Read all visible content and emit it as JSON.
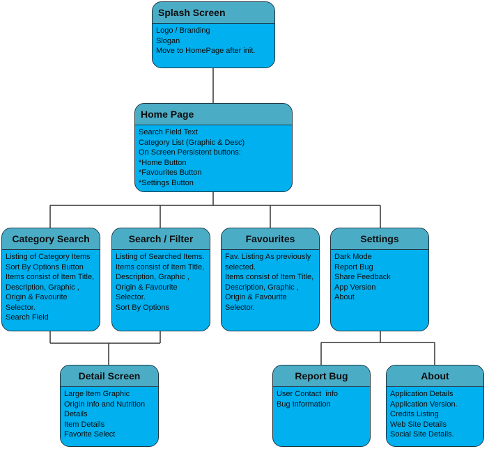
{
  "diagram": {
    "type": "sitemap",
    "colors": {
      "header": "#4bacc6",
      "body": "#00b0ef",
      "border": "#1f3640",
      "connector": "#333333"
    },
    "nodes": {
      "splash": {
        "title": "Splash Screen",
        "lines": [
          "Logo / Branding",
          "Slogan",
          "Move to HomePage after init."
        ]
      },
      "home": {
        "title": "Home Page",
        "lines": [
          "Search Field Text",
          "Category List (Graphic & Desc)",
          "On Screen Persistent buttons:",
          "*Home Button",
          "*Favourites Button",
          "*Settings Button"
        ]
      },
      "category_search": {
        "title": "Category Search",
        "lines": [
          "Listing of Category Items",
          "Sort By Options Button",
          "Items consist of Item Title,",
          "Description, Graphic ,",
          "Origin & Favourite",
          "Selector.",
          "Search Field"
        ]
      },
      "search_filter": {
        "title": "Search / Filter",
        "lines": [
          "Listing of Searched Items.",
          "Items consist of Item Title,",
          "Description, Graphic ,",
          "Origin & Favourite",
          "Selector.",
          "Sort By Options"
        ]
      },
      "favourites": {
        "title": "Favourites",
        "lines": [
          "Fav. Listing As previously",
          "selected.",
          "Items consist of Item Title,",
          "Description, Graphic ,",
          "Origin & Favourite",
          "Selector."
        ]
      },
      "settings": {
        "title": "Settings",
        "lines": [
          "Dark Mode",
          "Report Bug",
          "Share Feedback",
          "App Version",
          "About"
        ]
      },
      "detail": {
        "title": "Detail Screen",
        "lines": [
          "Large Item Graphic",
          "Origin Info and Nutrition",
          "Details",
          "Item Details",
          "Favorite Select"
        ]
      },
      "report_bug": {
        "title": "Report Bug",
        "lines": [
          "User Contact  info",
          "Bug Information"
        ]
      },
      "about": {
        "title": "About",
        "lines": [
          "Application Details",
          "Application Version.",
          "Credits Listing",
          "Web Site Details",
          "Social Site Details."
        ]
      }
    },
    "edges": [
      [
        "splash",
        "home"
      ],
      [
        "home",
        "category_search"
      ],
      [
        "home",
        "search_filter"
      ],
      [
        "home",
        "favourites"
      ],
      [
        "home",
        "settings"
      ],
      [
        "category_search",
        "detail"
      ],
      [
        "search_filter",
        "detail"
      ],
      [
        "settings",
        "report_bug"
      ],
      [
        "settings",
        "about"
      ]
    ]
  }
}
